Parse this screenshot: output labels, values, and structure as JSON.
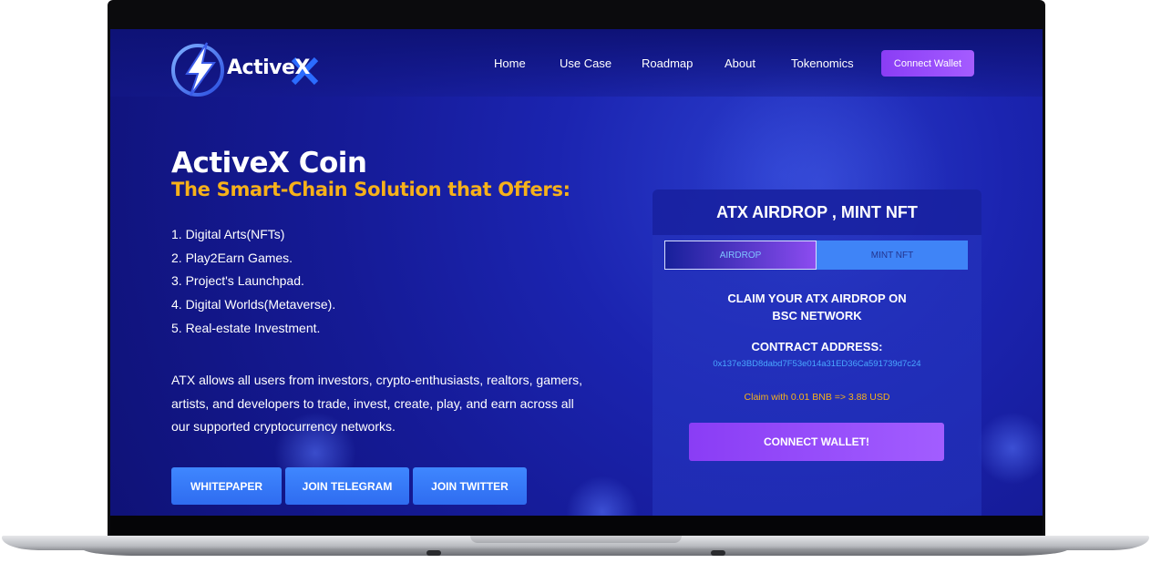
{
  "brand": {
    "name": "ActiveX",
    "accent": "#f6b11a",
    "primary": "#2f6cf0",
    "purple": "#8a3df5"
  },
  "nav": {
    "links": [
      "Home",
      "Use Case",
      "Roadmap",
      "About",
      "Tokenomics"
    ],
    "connect_label": "Connect Wallet"
  },
  "hero": {
    "title": "ActiveX Coin",
    "subtitle": "The Smart-Chain Solution that Offers:",
    "features": [
      "1. Digital Arts(NFTs)",
      "2. Play2Earn Games.",
      "3. Project's Launchpad.",
      "4. Digital Worlds(Metaverse).",
      "5. Real-estate Investment."
    ],
    "description": "ATX allows all users from investors, crypto-enthusiasts, realtors, gamers, artists, and developers to trade, invest, create, play, and earn across all our supported cryptocurrency networks.",
    "buttons": [
      "WHITEPAPER",
      "JOIN TELEGRAM",
      "JOIN TWITTER"
    ]
  },
  "airdrop": {
    "title": "ATX AIRDROP , MINT NFT",
    "tabs": [
      "AIRDROP",
      "MINT NFT"
    ],
    "active_tab": "AIRDROP",
    "claim_line1": "CLAIM YOUR ATX AIRDROP ON",
    "claim_line2": "BSC NETWORK",
    "contract_label": "CONTRACT ADDRESS:",
    "contract_address": "0x137e3BD8dabd7F53e014a31ED36Ca591739d7c24",
    "claim_rate": "Claim with 0.01 BNB => 3.88 USD",
    "connect_label": "CONNECT WALLET!"
  },
  "icons": {
    "logo": "lightning-bolt-logo-icon"
  }
}
